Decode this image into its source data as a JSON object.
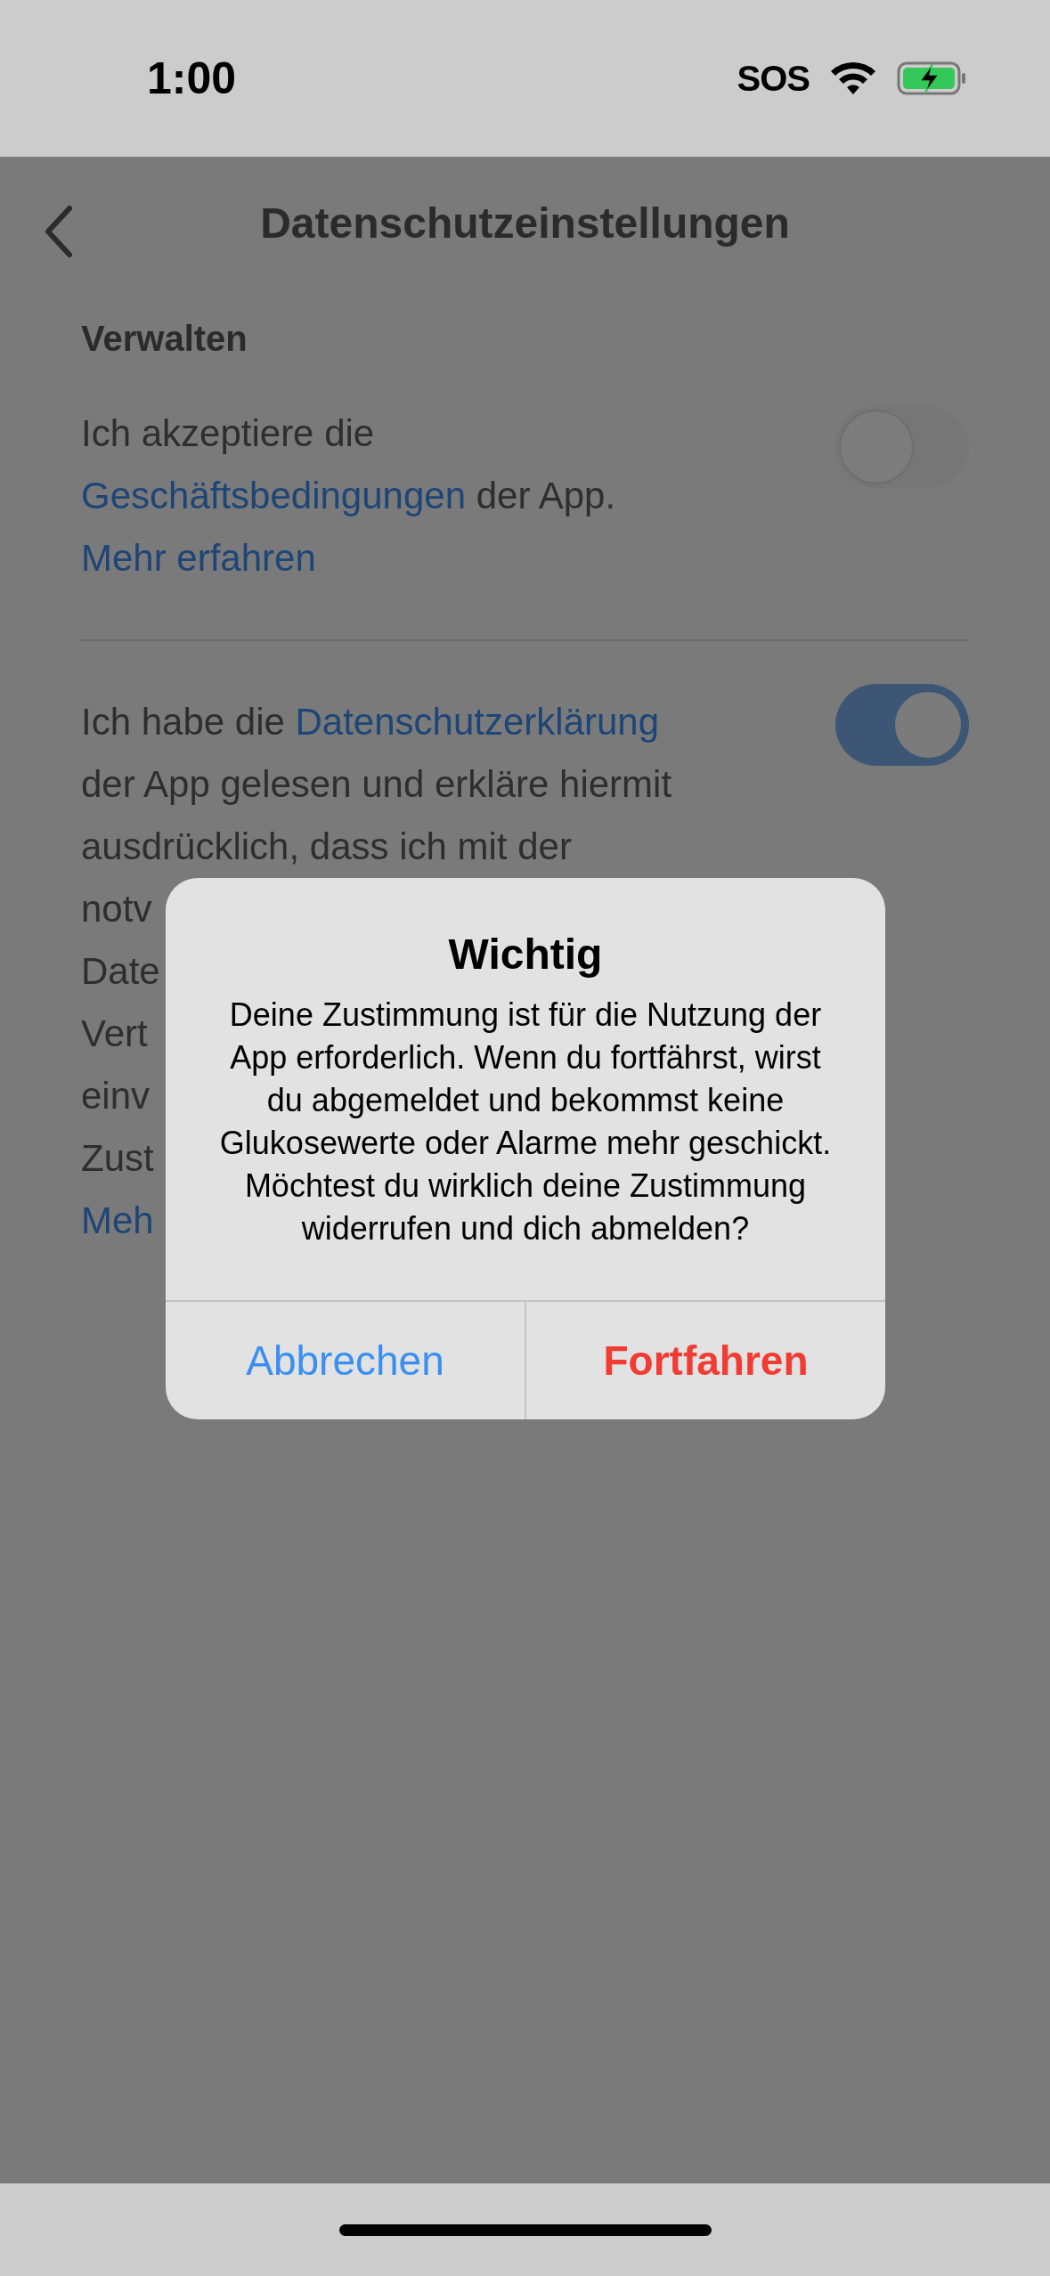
{
  "status_bar": {
    "time": "1:00",
    "sos": "SOS"
  },
  "nav": {
    "title": "Datenschutzeinstellungen"
  },
  "section": "Verwalten",
  "items": [
    {
      "on": false,
      "lines": [
        [
          {
            "text": "Ich akzeptiere die",
            "link": false
          }
        ],
        [
          {
            "text": "Geschäftsbedingungen",
            "link": true
          },
          {
            "text": " der App.",
            "link": false
          }
        ],
        [
          {
            "text": "Mehr erfahren",
            "link": true
          }
        ]
      ]
    },
    {
      "on": true,
      "lines": [
        [
          {
            "text": "Ich habe die ",
            "link": false
          },
          {
            "text": "Datenschutzerklärung",
            "link": true
          }
        ],
        [
          {
            "text": "der App gelesen und erkläre hiermit",
            "link": false
          }
        ],
        [
          {
            "text": "ausdrücklich, dass ich mit der",
            "link": false
          }
        ],
        [
          {
            "text": "notv",
            "link": false
          }
        ],
        [
          {
            "text": "Date",
            "link": false
          }
        ],
        [
          {
            "text": "Vert",
            "link": false
          }
        ],
        [
          {
            "text": "einv",
            "link": false
          }
        ],
        [
          {
            "text": "Zust",
            "link": false
          }
        ],
        [
          {
            "text": "Meh",
            "link": true
          }
        ]
      ]
    }
  ],
  "dialog": {
    "title": "Wichtig",
    "message": "Deine Zustimmung ist für die Nutzung der App erforderlich. Wenn du fortfährst, wirst du abgemeldet und bekommst keine Glukosewerte oder Alarme mehr geschickt. Möchtest du wirklich deine Zustimmung widerrufen und dich abmelden?",
    "buttons": [
      {
        "label": "Abbrechen",
        "kind": "cancel"
      },
      {
        "label": "Fortfahren",
        "kind": "destructive"
      }
    ]
  }
}
